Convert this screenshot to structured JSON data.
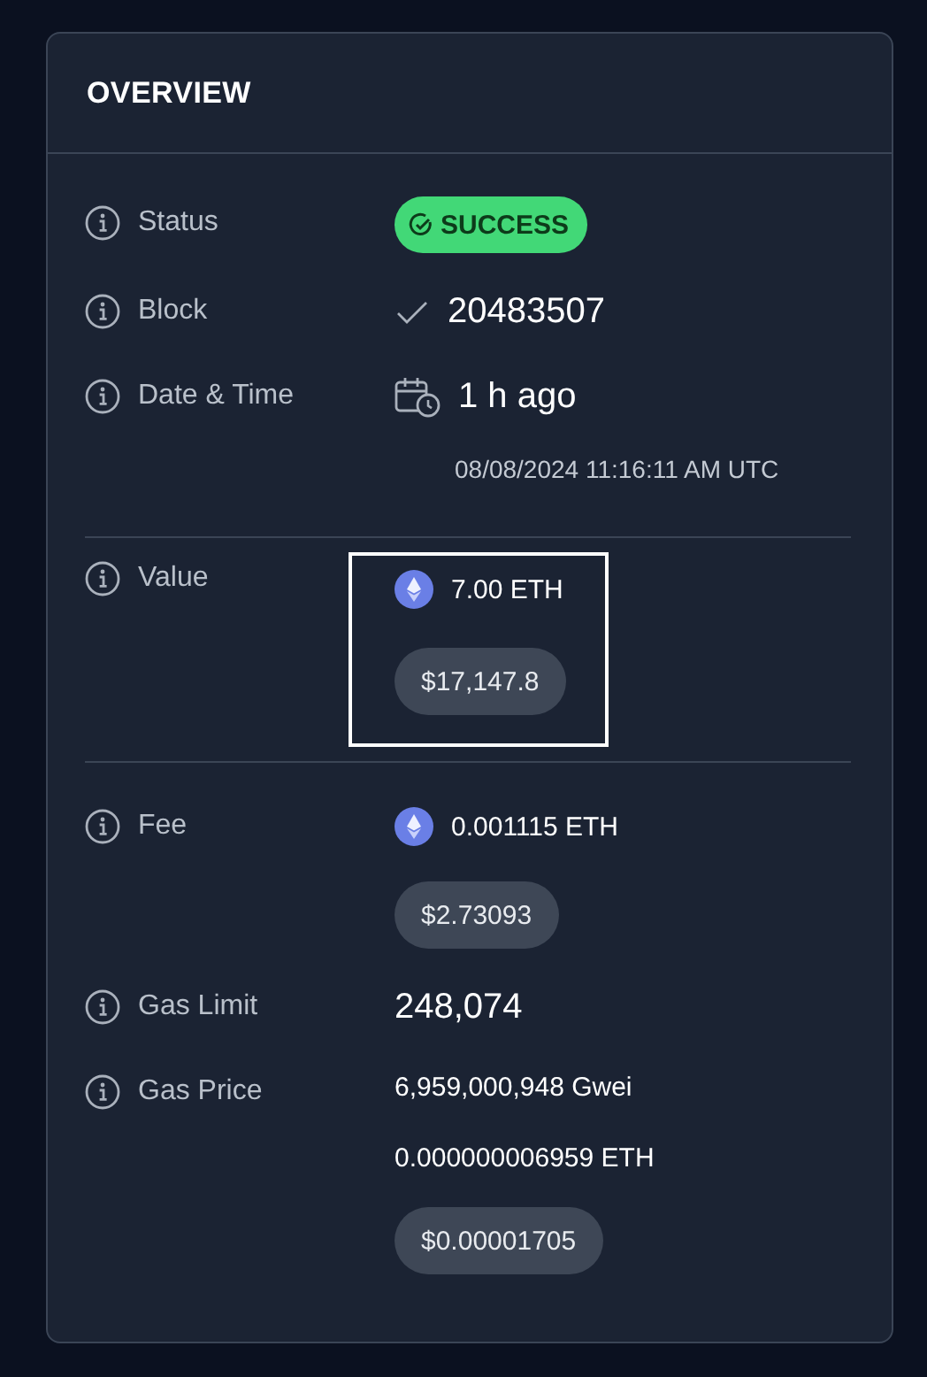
{
  "header": {
    "title": "OVERVIEW"
  },
  "sections": [
    {
      "rows": [
        {
          "label": "Status",
          "highlighted": false,
          "lines": [
            {
              "kind": "status",
              "text": "SUCCESS"
            }
          ]
        },
        {
          "label": "Block",
          "highlighted": false,
          "lines": [
            {
              "kind": "block",
              "text": "20483507"
            }
          ]
        },
        {
          "label": "Date & Time",
          "highlighted": false,
          "lines": [
            {
              "kind": "age",
              "text": "1 h ago"
            },
            {
              "kind": "note",
              "text": "08/08/2024 11:16:11 AM UTC"
            }
          ]
        }
      ]
    },
    {
      "rows": [
        {
          "label": "Value",
          "highlighted": true,
          "lines": [
            {
              "kind": "eth",
              "text": "7.00 ETH"
            },
            {
              "kind": "usd",
              "text": "$17,147.8"
            }
          ]
        }
      ]
    },
    {
      "rows": [
        {
          "label": "Fee",
          "highlighted": false,
          "lines": [
            {
              "kind": "eth",
              "text": "0.001115 ETH"
            },
            {
              "kind": "usd",
              "text": "$2.73093"
            }
          ]
        },
        {
          "label": "Gas Limit",
          "highlighted": false,
          "lines": [
            {
              "kind": "large",
              "text": "248,074"
            }
          ]
        },
        {
          "label": "Gas Price",
          "highlighted": false,
          "lines": [
            {
              "kind": "plain",
              "text": "6,959,000,948 Gwei"
            },
            {
              "kind": "plain",
              "text": "0.000000006959 ETH"
            },
            {
              "kind": "usd",
              "text": "$0.00001705"
            }
          ]
        }
      ]
    }
  ]
}
